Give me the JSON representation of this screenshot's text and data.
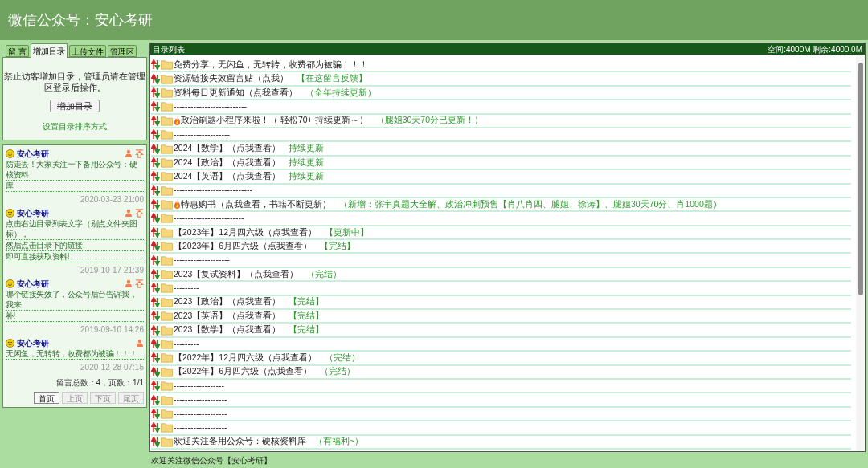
{
  "header": {
    "title": "微信公众号：安心考研"
  },
  "tabs": [
    {
      "label": "留 言",
      "selected": false
    },
    {
      "label": "增加目录",
      "selected": true
    },
    {
      "label": "上传文件",
      "selected": false
    },
    {
      "label": "管理区",
      "selected": false
    }
  ],
  "tab_panel": {
    "notice": "禁止访客增加目录，管理员请在管理区登录后操作。",
    "button": {
      "label": "增加目录",
      "disabled": true
    },
    "link": "设置目录排序方式"
  },
  "messages": [
    {
      "author": "安心考研",
      "pinned": true,
      "lines": [
        "防走丢！大家关注一下备用公众号：硬核资料",
        "库"
      ],
      "date": "2020-03-23 21:00"
    },
    {
      "author": "安心考研",
      "pinned": true,
      "lines": [
        "点击右边目录列表文字（别点文件夹图标），",
        "然后点击目录下的链接,",
        "即可直接获取资料!"
      ],
      "date": "2019-10-17 21:39"
    },
    {
      "author": "安心考研",
      "pinned": true,
      "lines": [
        "哪个链接失效了，公众号后台告诉我，我来",
        "补!"
      ],
      "date": "2019-09-10 14:26"
    },
    {
      "author": "安心考研",
      "pinned": false,
      "lines": [
        "无闲鱼，无转转，收费都为被骗！！！"
      ],
      "date": "2020-12-28 07:15"
    }
  ],
  "message_summary": "留言总数：4，页数：1/1",
  "pager": [
    {
      "label": "首页",
      "disabled": false
    },
    {
      "label": "上页",
      "disabled": true
    },
    {
      "label": "下页",
      "disabled": true
    },
    {
      "label": "尾页",
      "disabled": true
    }
  ],
  "directory": {
    "title": "目录列表",
    "quota": "空间:4000M 剩余:4000.0M",
    "rows": [
      {
        "name": "免费分享，无闲鱼，无转转，收费都为被骗！！！",
        "hot": false
      },
      {
        "name": "资源链接失效留言贴（点我）",
        "note": "【在这留言反馈】",
        "hot": false
      },
      {
        "name": "资料每日更新通知（点我查看）",
        "note": "（全年持续更新）",
        "hot": false
      },
      {
        "name": "--------------------------",
        "hot": false
      },
      {
        "name": "政治刷题小程序来啦！（ 轻松70+ 持续更新～）",
        "note": "（腿姐30天70分已更新！）",
        "hot": true
      },
      {
        "name": "--------------------",
        "hot": false
      },
      {
        "name": "2024【数学】（点我查看）",
        "note": "持续更新",
        "hot": false
      },
      {
        "name": "2024【政治】（点我查看）",
        "note": "持续更新",
        "hot": false
      },
      {
        "name": "2024【英语】（点我查看）",
        "note": "持续更新",
        "hot": false
      },
      {
        "name": "----------------------------",
        "hot": false
      },
      {
        "name": "特惠购书（点我查看，书籍不断更新）",
        "note": "（新增：张宇真题大全解、政治冲刺预售【肖八肖四、腿姐、徐涛】、腿姐30天70分、肖1000题）",
        "hot": true
      },
      {
        "name": "-------------------------",
        "hot": false
      },
      {
        "name": "【2023年】12月四六级（点我查看）",
        "note": "【更新中】",
        "hot": false
      },
      {
        "name": "【2023年】6月四六级（点我查看）",
        "note": "【完结】",
        "hot": false
      },
      {
        "name": "--------------------",
        "hot": false
      },
      {
        "name": "2023【复试资料】（点我查看）",
        "note": "（完结）",
        "hot": false
      },
      {
        "name": "---------",
        "hot": false
      },
      {
        "name": "2023【政治】（点我查看）",
        "note": "【完结】",
        "hot": false
      },
      {
        "name": "2023【英语】（点我查看）",
        "note": "【完结】",
        "hot": false
      },
      {
        "name": "2023【数学】（点我查看）",
        "note": "【完结】",
        "hot": false
      },
      {
        "name": "---------",
        "hot": false
      },
      {
        "name": "【2022年】12月四六级（点我查看）",
        "note": "（完结）",
        "hot": false
      },
      {
        "name": "【2022年】6月四六级（点我查看）",
        "note": "（完结）",
        "hot": false
      },
      {
        "name": "------------------",
        "hot": false
      },
      {
        "name": "-------------------",
        "hot": false
      },
      {
        "name": "-------------------",
        "hot": false
      },
      {
        "name": "-------------------",
        "hot": false
      },
      {
        "name": "欢迎关注备用公众号：硬核资料库",
        "note": "（有福利~）",
        "hot": false
      }
    ]
  },
  "footer": "欢迎关注微信公众号【安心考研】"
}
